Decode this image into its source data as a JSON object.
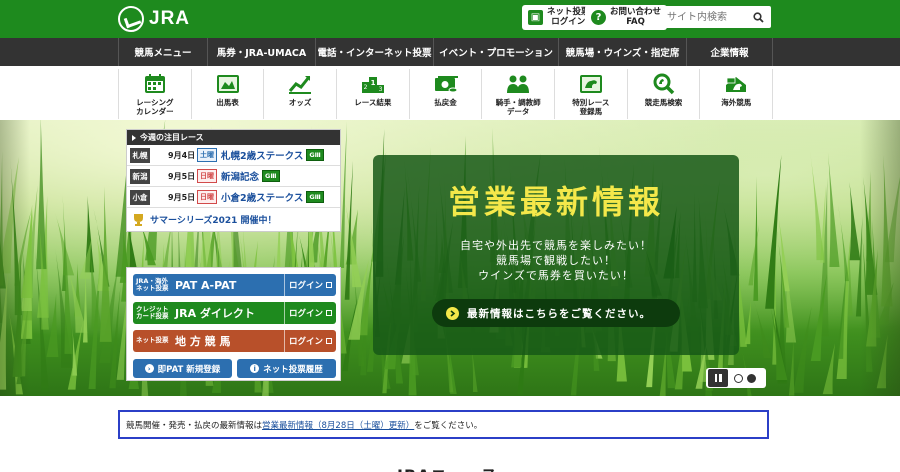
{
  "header": {
    "logo_text": "JRA",
    "net_vote_login": "ネット投票\nログイン",
    "faq": "お問い合わせ\nFAQ",
    "search_placeholder": "サイト内検索"
  },
  "gnav": [
    {
      "label": "競馬メニュー"
    },
    {
      "label": "馬券・JRA-UMACA"
    },
    {
      "label": "電話・インターネット投票"
    },
    {
      "label": "イベント・プロモーション"
    },
    {
      "label": "競馬場・ウインズ・指定席"
    },
    {
      "label": "企業情報"
    }
  ],
  "icon_menu": [
    {
      "label": "レーシング\nカレンダー",
      "icon": "calendar-icon"
    },
    {
      "label": "出馬表",
      "icon": "entries-icon"
    },
    {
      "label": "オッズ",
      "icon": "odds-chart-icon"
    },
    {
      "label": "レース結果",
      "icon": "podium-icon"
    },
    {
      "label": "払戻金",
      "icon": "payout-icon"
    },
    {
      "label": "騎手・調教師\nデータ",
      "icon": "jockey-icon"
    },
    {
      "label": "特別レース\n登録馬",
      "icon": "registered-horse-icon"
    },
    {
      "label": "競走馬検索",
      "icon": "horse-search-icon"
    },
    {
      "label": "海外競馬",
      "icon": "overseas-racing-icon"
    }
  ],
  "races": {
    "heading": "今週の注目レース",
    "items": [
      {
        "venue": "札幌",
        "date": "9月4日",
        "day": "土曜",
        "name": "札幌2歳ステークス",
        "grade": "GⅢ"
      },
      {
        "venue": "新潟",
        "date": "9月5日",
        "day": "日曜",
        "name": "新潟記念",
        "grade": "GⅢ"
      },
      {
        "venue": "小倉",
        "date": "9月5日",
        "day": "日曜",
        "name": "小倉2歳ステークス",
        "grade": "GⅢ"
      }
    ],
    "summer_series": "サマーシリーズ2021 開催中！"
  },
  "promo": {
    "title": "営業最新情報",
    "line1": "自宅や外出先で競馬を楽しみたい！",
    "line2": "競馬場で観戦したい！",
    "line3": "ウインズで馬券を買いたい！",
    "button": "最新情報はこちらをご覧ください。"
  },
  "pat": {
    "rows": [
      {
        "small": "JRA・海外\nネット投票",
        "big": "PAT A-PAT",
        "login": "ログイン",
        "color": "#2c6fb0"
      },
      {
        "small": "クレジット\nカード投票",
        "big": "JRA ダイレクト",
        "login": "ログイン",
        "color": "#1e8a1e"
      },
      {
        "small": "ネット投票",
        "big": "地 方 競 馬",
        "login": "ログイン",
        "color": "#b8502a"
      }
    ],
    "new_register": "即PAT 新規登録",
    "history": "ネット投票履歴"
  },
  "notice": {
    "prefix": "競馬開催・発売・払戻の最新情報は",
    "link": "営業最新情報（8月28日（土曜）更新）",
    "suffix": "をご覧ください。"
  },
  "news_title": "JRAニュース",
  "colors": {
    "brand_green": "#1e8a1e",
    "nav_dark": "#333333",
    "promo_yellow": "#f4e84a",
    "link_blue": "#1a4f9c",
    "notice_border": "#2b3fc7"
  }
}
